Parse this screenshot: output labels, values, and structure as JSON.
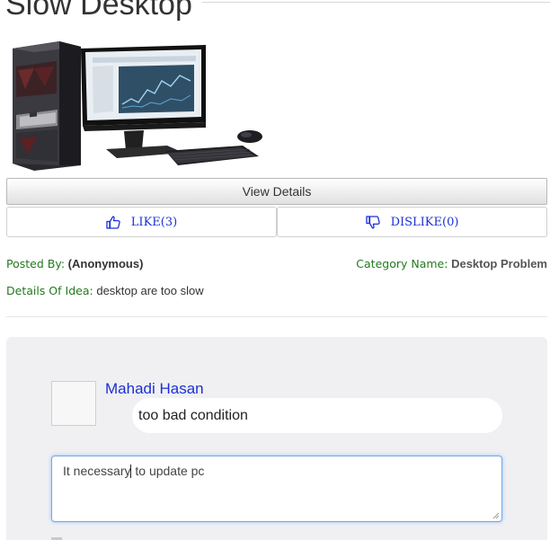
{
  "page": {
    "title": "Slow Desktop"
  },
  "hero": {
    "alt": "Desktop computer with monitor, keyboard and mouse"
  },
  "actions": {
    "view_details": "View Details",
    "like": "LIKE(3)",
    "dislike": "DISLIKE(0)",
    "like_count": 3,
    "dislike_count": 0
  },
  "meta": {
    "posted_by_label": "Posted By:",
    "posted_by_value": "(Anonymous)",
    "category_label": "Category Name:",
    "category_value": "Desktop Problem",
    "details_label": "Details Of Idea:",
    "details_value": "desktop are too slow"
  },
  "comment": {
    "author": "Mahadi Hasan",
    "text": "too bad condition"
  },
  "reply": {
    "before_caret": "It necessary",
    "after_caret": " to update pc"
  },
  "colors": {
    "link_blue": "#1b2fd6",
    "label_green": "#237a1f",
    "panel_gray": "#f0f0f3",
    "focus_blue": "#74a8ec"
  },
  "icons": {
    "like": "thumbs-up-icon",
    "dislike": "thumbs-down-icon"
  }
}
